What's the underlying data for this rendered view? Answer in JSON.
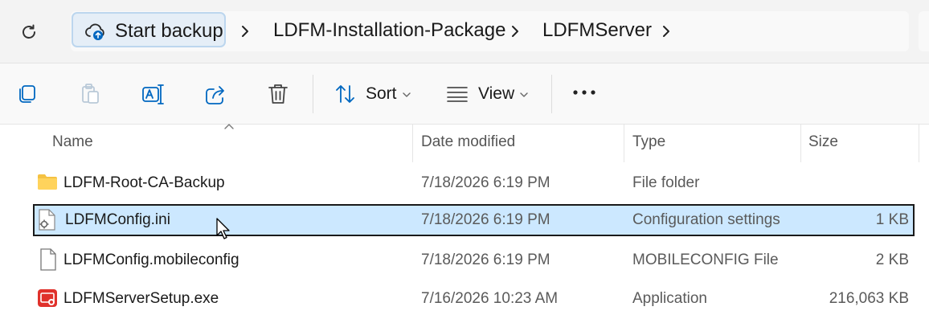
{
  "address_bar": {
    "backup_button": "Start backup",
    "breadcrumbs": [
      "LDFM-Installation-Package",
      "LDFMServer"
    ]
  },
  "command_bar": {
    "sort_label": "Sort",
    "view_label": "View"
  },
  "columns": {
    "name": "Name",
    "date": "Date modified",
    "type": "Type",
    "size": "Size"
  },
  "files": [
    {
      "name": "LDFM-Root-CA-Backup",
      "date": "7/18/2026 6:19 PM",
      "type": "File folder",
      "size": "",
      "icon": "folder-icon"
    },
    {
      "name": "LDFMConfig.ini",
      "date": "7/18/2026 6:19 PM",
      "type": "Configuration settings",
      "size": "1 KB",
      "icon": "config-file-icon",
      "selected": true
    },
    {
      "name": "LDFMConfig.mobileconfig",
      "date": "7/18/2026 6:19 PM",
      "type": "MOBILECONFIG File",
      "size": "2 KB",
      "icon": "blank-file-icon"
    },
    {
      "name": "LDFMServerSetup.exe",
      "date": "7/16/2026 10:23 AM",
      "type": "Application",
      "size": "216,063 KB",
      "icon": "application-icon"
    }
  ],
  "colors": {
    "selection_bg": "#cce8ff",
    "backup_button_bg": "#e5eef7",
    "accent": "#0067c0",
    "exe_icon": "#e0312b",
    "folder": "#f5c242"
  }
}
